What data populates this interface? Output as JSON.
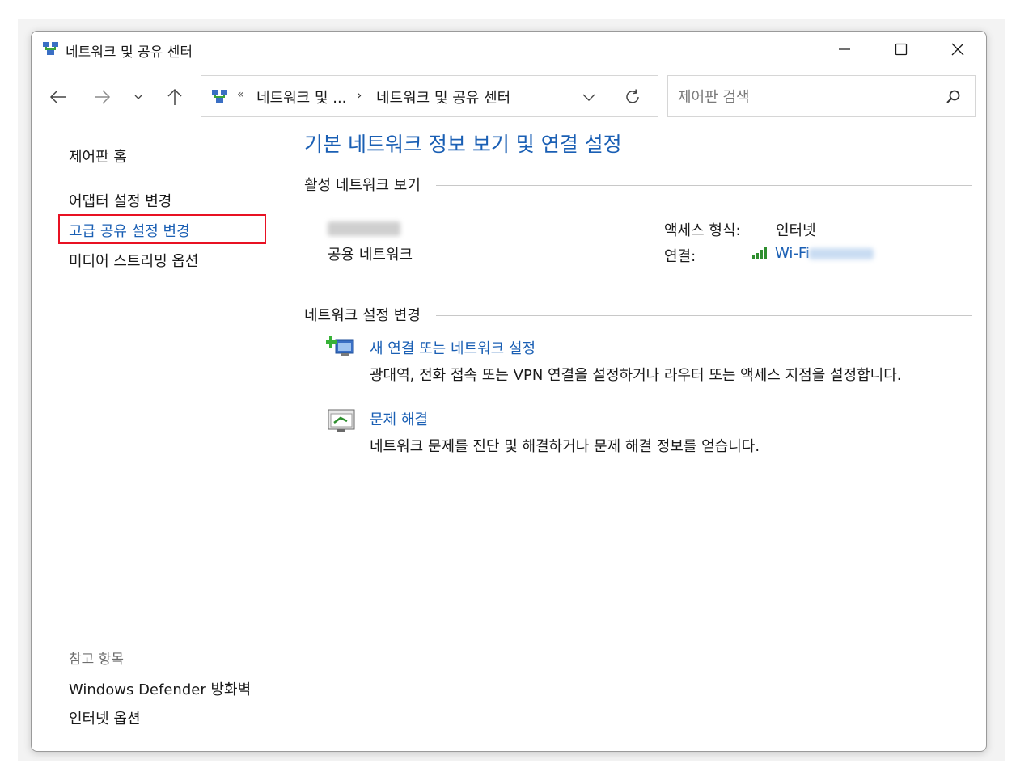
{
  "window": {
    "title": "네트워크 및 공유 센터"
  },
  "address": {
    "overflow": "«",
    "segment1": "네트워크 및 ...",
    "separator": "›",
    "segment2": "네트워크 및 공유 센터"
  },
  "search": {
    "placeholder": "제어판 검색"
  },
  "sidebar": {
    "home": "제어판 홈",
    "links": [
      "어댑터 설정 변경",
      "고급 공유 설정 변경",
      "미디어 스트리밍 옵션"
    ],
    "see_also_title": "참고 항목",
    "see_also": [
      "Windows Defender 방화벽",
      "인터넷 옵션"
    ]
  },
  "main": {
    "title": "기본 네트워크 정보 보기 및 연결 설정",
    "active_header": "활성 네트워크 보기",
    "network": {
      "type": "공용 네트워크",
      "access_label": "액세스 형식:",
      "access_value": "인터넷",
      "connection_label": "연결:",
      "connection_value": "Wi-Fi"
    },
    "change_header": "네트워크 설정 변경",
    "tasks": [
      {
        "link": "새 연결 또는 네트워크 설정",
        "desc": "광대역, 전화 접속 또는 VPN 연결을 설정하거나 라우터 또는 액세스 지점을 설정합니다."
      },
      {
        "link": "문제 해결",
        "desc": "네트워크 문제를 진단 및 해결하거나 문제 해결 정보를 얻습니다."
      }
    ]
  },
  "colors": {
    "link": "#1a5fb4",
    "highlight": "#e81123"
  }
}
